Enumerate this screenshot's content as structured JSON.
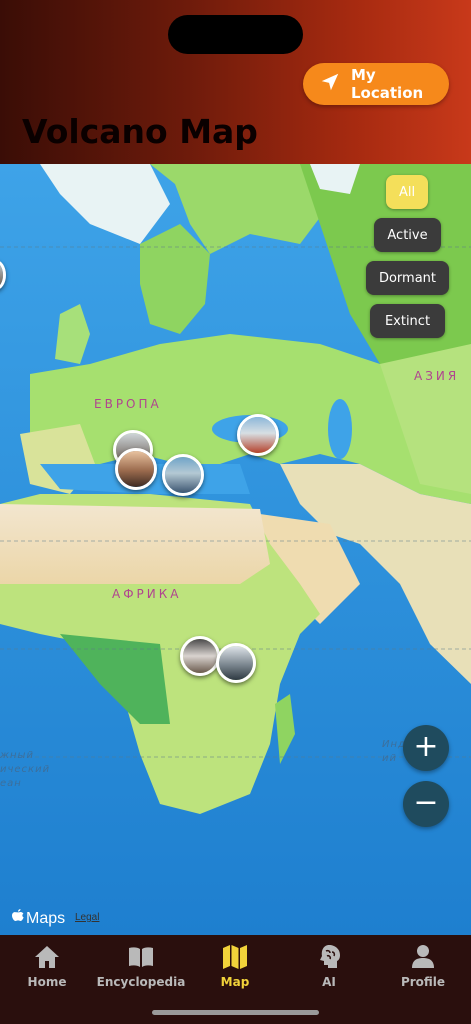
{
  "header": {
    "title": "Volcano Map",
    "location_button": "My Location"
  },
  "map": {
    "region_labels": {
      "europe": "ЕВРОПА",
      "asia": "АЗИЯ",
      "africa": "АФРИКА"
    },
    "ocean_labels": {
      "atlantic": [
        "жный",
        "ический",
        "еан"
      ],
      "indian": [
        "Инд",
        "ий"
      ]
    },
    "filters": [
      "All",
      "Active",
      "Dormant",
      "Extinct"
    ],
    "selected_filter": "All",
    "zoom_in": "+",
    "zoom_out": "−",
    "attribution": "Maps",
    "legal": "Legal"
  },
  "tabs": [
    {
      "label": "Home",
      "icon": "house-icon"
    },
    {
      "label": "Encyclopedia",
      "icon": "book-icon"
    },
    {
      "label": "Map",
      "icon": "map-icon"
    },
    {
      "label": "AI",
      "icon": "brain-icon"
    },
    {
      "label": "Profile",
      "icon": "person-icon"
    }
  ],
  "selected_tab": "Map",
  "colors": {
    "accent_orange": "#f6891b",
    "selected_tab": "#f1d23a",
    "tab_bar": "#2a0f0d",
    "filter_button": "#3b3b3b",
    "filter_selected": "#f4df5a"
  }
}
